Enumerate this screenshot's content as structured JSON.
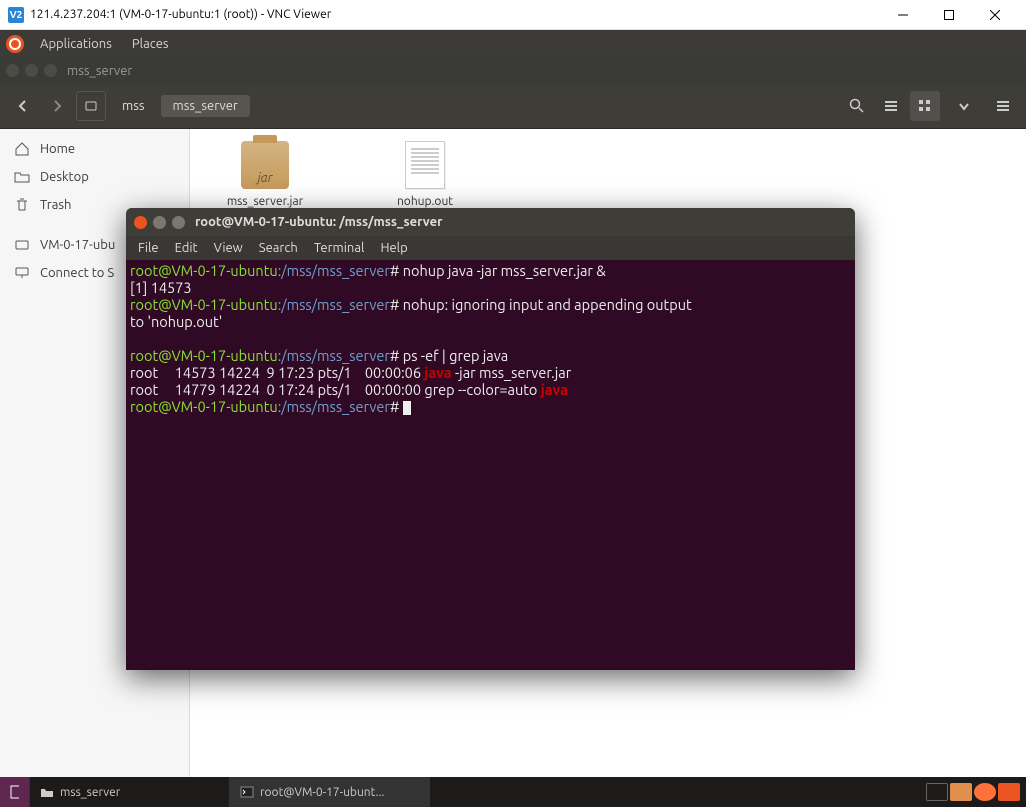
{
  "vnc": {
    "icon_text": "V2",
    "title": "121.4.237.204:1 (VM-0-17-ubuntu:1 (root)) - VNC Viewer"
  },
  "ubuntu_menu": {
    "applications": "Applications",
    "places": "Places"
  },
  "fm": {
    "window_title": "mss_server",
    "crumb1": "mss",
    "crumb2": "mss_server",
    "sidebar": {
      "home": "Home",
      "desktop": "Desktop",
      "trash": "Trash",
      "vm": "VM-0-17-ubu",
      "connect": "Connect to S"
    },
    "files": {
      "jar_label": "jar",
      "jar": "mss_server.jar",
      "nohup": "nohup.out"
    }
  },
  "terminal": {
    "title": "root@VM-0-17-ubuntu: /mss/mss_server",
    "menu": {
      "file": "File",
      "edit": "Edit",
      "view": "View",
      "search": "Search",
      "terminal": "Terminal",
      "help": "Help"
    },
    "lines": {
      "p1_user": "root@VM-0-17-ubuntu",
      "p1_path": ":/mss/mss_server",
      "p1_sep": "# ",
      "cmd1": "nohup java -jar mss_server.jar &",
      "l2": "[1] 14573",
      "msg1": "nohup: ignoring input and appending output ",
      "msg2": "to 'nohup.out'",
      "cmd2": "ps -ef | grep java",
      "ps1a": "root     14573 14224  9 17:23 pts/1    00:00:06 ",
      "ps1b": "java",
      "ps1c": " -jar mss_server.jar",
      "ps2a": "root     14779 14224  0 17:24 pts/1    00:00:00 grep --color=auto ",
      "ps2b": "java"
    }
  },
  "taskbar": {
    "item1": "mss_server",
    "item2": "root@VM-0-17-ubunt..."
  }
}
